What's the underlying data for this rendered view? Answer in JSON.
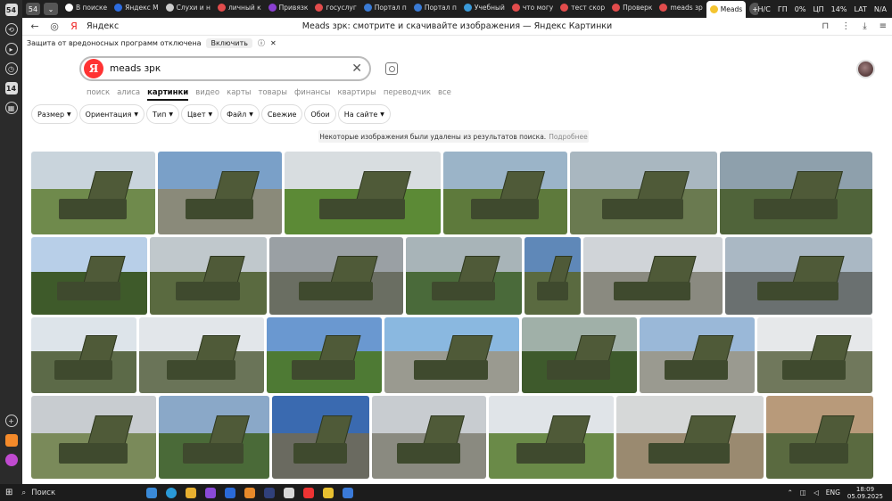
{
  "browser": {
    "tab_counter": "54",
    "tabs": [
      {
        "label": "В поиске",
        "color": "#ffffff"
      },
      {
        "label": "Яндекс М",
        "color": "#2d6cdf"
      },
      {
        "label": "Слухи и н",
        "color": "#cccccc"
      },
      {
        "label": "личный к",
        "color": "#e24c4c"
      },
      {
        "label": "Привязк",
        "color": "#8a3fd1"
      },
      {
        "label": "госуслуг",
        "color": "#e24c4c"
      },
      {
        "label": "Портал п",
        "color": "#3a7bd5"
      },
      {
        "label": "Портал п",
        "color": "#3a7bd5"
      },
      {
        "label": "Учебный",
        "color": "#3a9ad9"
      },
      {
        "label": "что могу",
        "color": "#e24c4c"
      },
      {
        "label": "тест скор",
        "color": "#e24c4c"
      },
      {
        "label": "Проверк",
        "color": "#e24c4c"
      },
      {
        "label": "meads зр",
        "color": "#e24c4c"
      },
      {
        "label": "Meads",
        "color": "#f4c430"
      }
    ],
    "system_indicators": [
      "Н/С",
      "ГП",
      "0%",
      "ЦП",
      "14%",
      "LAT",
      "N/A"
    ],
    "domain": "Яндекс",
    "page_title": "Meads зрк: смотрите и скачивайте изображения — Яндекс Картинки",
    "protection_text": "Защита от вредоносных программ отключена",
    "protection_button": "Включить"
  },
  "search": {
    "logo": "Я",
    "query": "meads зрк",
    "services": [
      "поиск",
      "алиса",
      "картинки",
      "видео",
      "карты",
      "товары",
      "финансы",
      "квартиры",
      "переводчик",
      "все"
    ],
    "active_service": "картинки",
    "filters": [
      {
        "label": "Размер",
        "chev": true
      },
      {
        "label": "Ориентация",
        "chev": true
      },
      {
        "label": "Тип",
        "chev": true
      },
      {
        "label": "Цвет",
        "chev": true
      },
      {
        "label": "Файл",
        "chev": true
      },
      {
        "label": "Свежие",
        "chev": false
      },
      {
        "label": "Обои",
        "chev": false
      },
      {
        "label": "На сайте",
        "chev": true
      }
    ],
    "notice": "Некоторые изображения были удалены из результатов поиска.",
    "notice_more": "Подробнее"
  },
  "results_rows": [
    [
      {
        "sky": "#c9d4dc",
        "ground": "#6f8a4c"
      },
      {
        "sky": "#7aa0c8",
        "ground": "#8a8a7a"
      },
      {
        "sky": "#d8dde0",
        "ground": "#5c8a36"
      },
      {
        "sky": "#9bb4c8",
        "ground": "#5e7a3c"
      },
      {
        "sky": "#a9b7c0",
        "ground": "#6a7a50"
      },
      {
        "sky": "#8ea0ac",
        "ground": "#50643a"
      }
    ],
    [
      {
        "sky": "#b8cfe8",
        "ground": "#3e5a2a"
      },
      {
        "sky": "#c0c8cc",
        "ground": "#5a6a40"
      },
      {
        "sky": "#9aa0a4",
        "ground": "#6a6e62"
      },
      {
        "sky": "#a8b4b8",
        "ground": "#4a6a3a"
      },
      {
        "sky": "#5f88b8",
        "ground": "#5a6a40"
      },
      {
        "sky": "#d0d4d8",
        "ground": "#8a8a80"
      },
      {
        "sky": "#aab8c4",
        "ground": "#6a7070"
      }
    ],
    [
      {
        "sky": "#dde4ea",
        "ground": "#5c6a48"
      },
      {
        "sky": "#e2e6ea",
        "ground": "#6a7458"
      },
      {
        "sky": "#6a98d0",
        "ground": "#4e7a34"
      },
      {
        "sky": "#8ab8e0",
        "ground": "#9a9a90"
      },
      {
        "sky": "#a0b0a8",
        "ground": "#3e5a2c"
      },
      {
        "sky": "#9ab8d8",
        "ground": "#9a9a90"
      },
      {
        "sky": "#e6e8ea",
        "ground": "#70785c"
      }
    ],
    [
      {
        "sky": "#c8ccd0",
        "ground": "#7a8a5a"
      },
      {
        "sky": "#8aa8c8",
        "ground": "#4a6a38"
      },
      {
        "sky": "#3a6ab0",
        "ground": "#6a6a60"
      },
      {
        "sky": "#c8ccd0",
        "ground": "#8a8a80"
      },
      {
        "sky": "#e0e4e8",
        "ground": "#6a8a48"
      },
      {
        "sky": "#d6d8d8",
        "ground": "#9a8a70"
      },
      {
        "sky": "#b89a7a",
        "ground": "#5a6a40"
      }
    ]
  ],
  "taskbar": {
    "search_label": "Поиск",
    "lang": "ENG",
    "time": "18:09",
    "date": "05.09.2025"
  }
}
